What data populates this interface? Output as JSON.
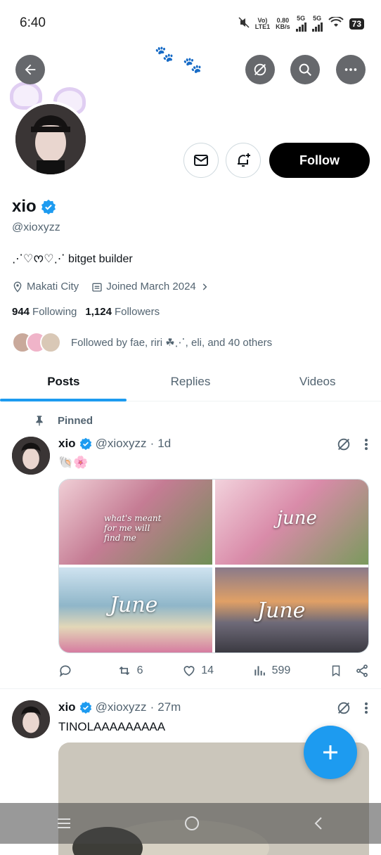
{
  "status_bar": {
    "time": "6:40",
    "network_type": "LTE1",
    "speed_value": "0.80",
    "speed_unit": "KB/s",
    "sim1_label": "5G",
    "sim2_label": "5G",
    "battery": "73"
  },
  "profile": {
    "name": "xio",
    "handle": "@xioxyzz",
    "bio": "⋰♡ᰔ♡⋰ bitget builder",
    "location": "Makati City",
    "joined": "Joined March 2024",
    "following_count": "944",
    "following_label": "Following",
    "followers_count": "1,124",
    "followers_label": "Followers",
    "followed_by": "Followed by fae, riri ☘︎⋰, eli, and 40 others",
    "follow_button": "Follow"
  },
  "tabs": [
    "Posts",
    "Replies",
    "Videos"
  ],
  "active_tab": "Posts",
  "pinned_label": "Pinned",
  "posts": [
    {
      "name": "xio",
      "handle": "@xioxyzz",
      "time": "1d",
      "text": "🐚🌸",
      "media_text": [
        "what's meant for me will find me",
        "june",
        "June",
        "June"
      ],
      "replies": "",
      "reposts": "6",
      "likes": "14",
      "views": "599"
    },
    {
      "name": "xio",
      "handle": "@xioxyzz",
      "time": "27m",
      "text": "TINOLAAAAAAAAA"
    }
  ],
  "colors": {
    "accent": "#1d9bf0",
    "verified": "#1d9bf0",
    "follow_bg": "#000000",
    "muted_text": "#536471"
  }
}
